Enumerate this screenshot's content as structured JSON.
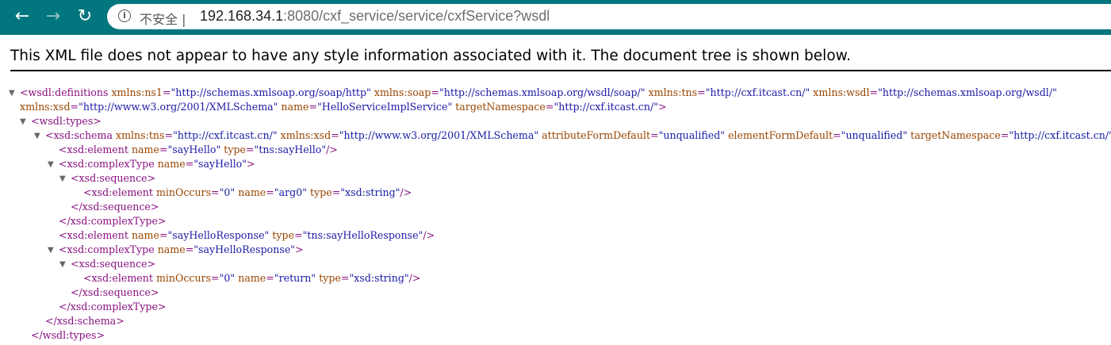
{
  "browser": {
    "back_icon": "arrow-left-icon",
    "forward_icon": "arrow-right-icon",
    "reload_icon": "reload-icon",
    "info_icon": "info-icon",
    "security_label": "不安全",
    "url_host": "192.168.34.1",
    "url_rest": ":8080/cxf_service/service/cxfService?wsdl"
  },
  "banner": "This XML file does not appear to have any style information associated with it. The document tree is shown below.",
  "tree_lines": [
    "<wsdl:definitions xmlns:ns1=\"http://schemas.xmlsoap.org/soap/http\" xmlns:soap=\"http://schemas.xmlsoap.org/wsdl/soap/\" xmlns:tns=\"http://cxf.itcast.cn/\" xmlns:wsdl=\"http://schemas.xmlsoap.org/wsdl/\"",
    "xmlns:xsd=\"http://www.w3.org/2001/XMLSchema\" name=\"HelloServiceImplService\" targetNamespace=\"http://cxf.itcast.cn/\">",
    "<wsdl:types>",
    "<xsd:schema xmlns:tns=\"http://cxf.itcast.cn/\" xmlns:xsd=\"http://www.w3.org/2001/XMLSchema\" attributeFormDefault=\"unqualified\" elementFormDefault=\"unqualified\" targetNamespace=\"http://cxf.itcast.cn/\">",
    "<xsd:element name=\"sayHello\" type=\"tns:sayHello\"/>",
    "<xsd:complexType name=\"sayHello\">",
    "<xsd:sequence>",
    "<xsd:element minOccurs=\"0\" name=\"arg0\" type=\"xsd:string\"/>",
    "</xsd:sequence>",
    "</xsd:complexType>",
    "<xsd:element name=\"sayHelloResponse\" type=\"tns:sayHelloResponse\"/>",
    "<xsd:complexType name=\"sayHelloResponse\">",
    "<xsd:sequence>",
    "<xsd:element minOccurs=\"0\" name=\"return\" type=\"xsd:string\"/>",
    "</xsd:sequence>",
    "</xsd:complexType>",
    "</xsd:schema>",
    "</wsdl:types>"
  ],
  "collapse_icon": "triangle-down-icon"
}
